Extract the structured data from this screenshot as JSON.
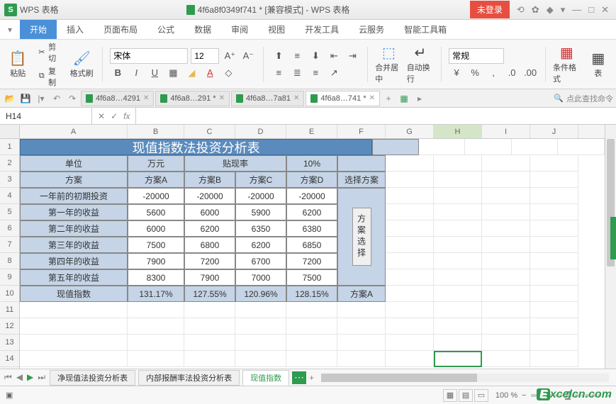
{
  "app": {
    "logo": "S",
    "name": "WPS 表格",
    "doc_title": "4f6a8f0349f741 * [兼容模式] - WPS 表格",
    "login": "未登录"
  },
  "menu": {
    "tabs": [
      "开始",
      "插入",
      "页面布局",
      "公式",
      "数据",
      "审阅",
      "视图",
      "开发工具",
      "云服务",
      "智能工具箱"
    ],
    "active": 0
  },
  "ribbon": {
    "paste": "粘贴",
    "cut": "剪切",
    "copy": "复制",
    "fmtpaint": "格式刷",
    "font": "宋体",
    "size": "12",
    "merge": "合并居中",
    "wrap": "自动换行",
    "numfmt": "常规",
    "condfmt": "条件格式",
    "tablefmt": "表"
  },
  "doctabs": {
    "items": [
      "4f6a8…4291",
      "4f6a8…291 *",
      "4f6a8…7a81",
      "4f6a8…741 *"
    ],
    "active": 3,
    "search": "点此查找命令"
  },
  "fx": {
    "name": "H14",
    "fx": "fx",
    "formula": ""
  },
  "cols": [
    "A",
    "B",
    "C",
    "D",
    "E",
    "F",
    "G",
    "H",
    "I",
    "J"
  ],
  "rows": [
    "1",
    "2",
    "3",
    "4",
    "5",
    "6",
    "7",
    "8",
    "9",
    "10",
    "11",
    "12",
    "13",
    "14"
  ],
  "table": {
    "title": "现值指数法投资分析表",
    "r2": {
      "unit_l": "单位",
      "unit_v": "万元",
      "rate_l": "贴现率",
      "rate_v": "10%"
    },
    "r3": {
      "plan": "方案",
      "a": "方案A",
      "b": "方案B",
      "c": "方案C",
      "d": "方案D",
      "sel": "选择方案"
    },
    "r4": {
      "l": "一年前的初期投资",
      "a": "-20000",
      "b": "-20000",
      "c": "-20000",
      "d": "-20000"
    },
    "r5": {
      "l": "第一年的收益",
      "a": "5600",
      "b": "6000",
      "c": "5900",
      "d": "6200"
    },
    "r6": {
      "l": "第二年的收益",
      "a": "6000",
      "b": "6200",
      "c": "6350",
      "d": "6380"
    },
    "r7": {
      "l": "第三年的收益",
      "a": "7500",
      "b": "6800",
      "c": "6200",
      "d": "6850"
    },
    "r8": {
      "l": "第四年的收益",
      "a": "7900",
      "b": "7200",
      "c": "6700",
      "d": "7200"
    },
    "r9": {
      "l": "第五年的收益",
      "a": "8300",
      "b": "7900",
      "c": "7000",
      "d": "7500"
    },
    "r10": {
      "l": "现值指数",
      "a": "131.17%",
      "b": "127.55%",
      "c": "120.96%",
      "d": "128.15%",
      "f": "方案A"
    },
    "vbtn": "方案选择"
  },
  "sheets": {
    "items": [
      "净现值法投资分析表",
      "内部报酬率法投资分析表",
      "现值指数"
    ],
    "active": 2,
    "more": "⋯"
  },
  "status": {
    "zoom": "100 %"
  },
  "watermark": "xcelcn.com"
}
